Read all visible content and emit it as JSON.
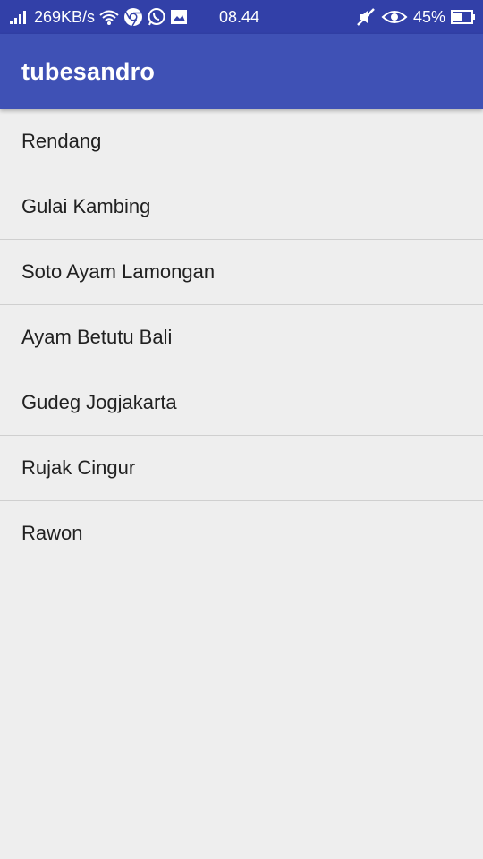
{
  "status_bar": {
    "network_speed": "269KB/s",
    "time": "08.44",
    "battery": "45%",
    "icons": [
      "signal-icon",
      "wifi-icon",
      "chrome-icon",
      "whatsapp-icon",
      "gallery-icon",
      "mute-icon",
      "eye-icon",
      "battery-icon"
    ]
  },
  "app_bar": {
    "title": "tubesandro",
    "color": "#3f51b5"
  },
  "list": {
    "items": [
      {
        "label": "Rendang"
      },
      {
        "label": "Gulai Kambing"
      },
      {
        "label": "Soto Ayam Lamongan"
      },
      {
        "label": "Ayam Betutu Bali"
      },
      {
        "label": "Gudeg Jogjakarta"
      },
      {
        "label": "Rujak Cingur"
      },
      {
        "label": "Rawon"
      }
    ]
  }
}
